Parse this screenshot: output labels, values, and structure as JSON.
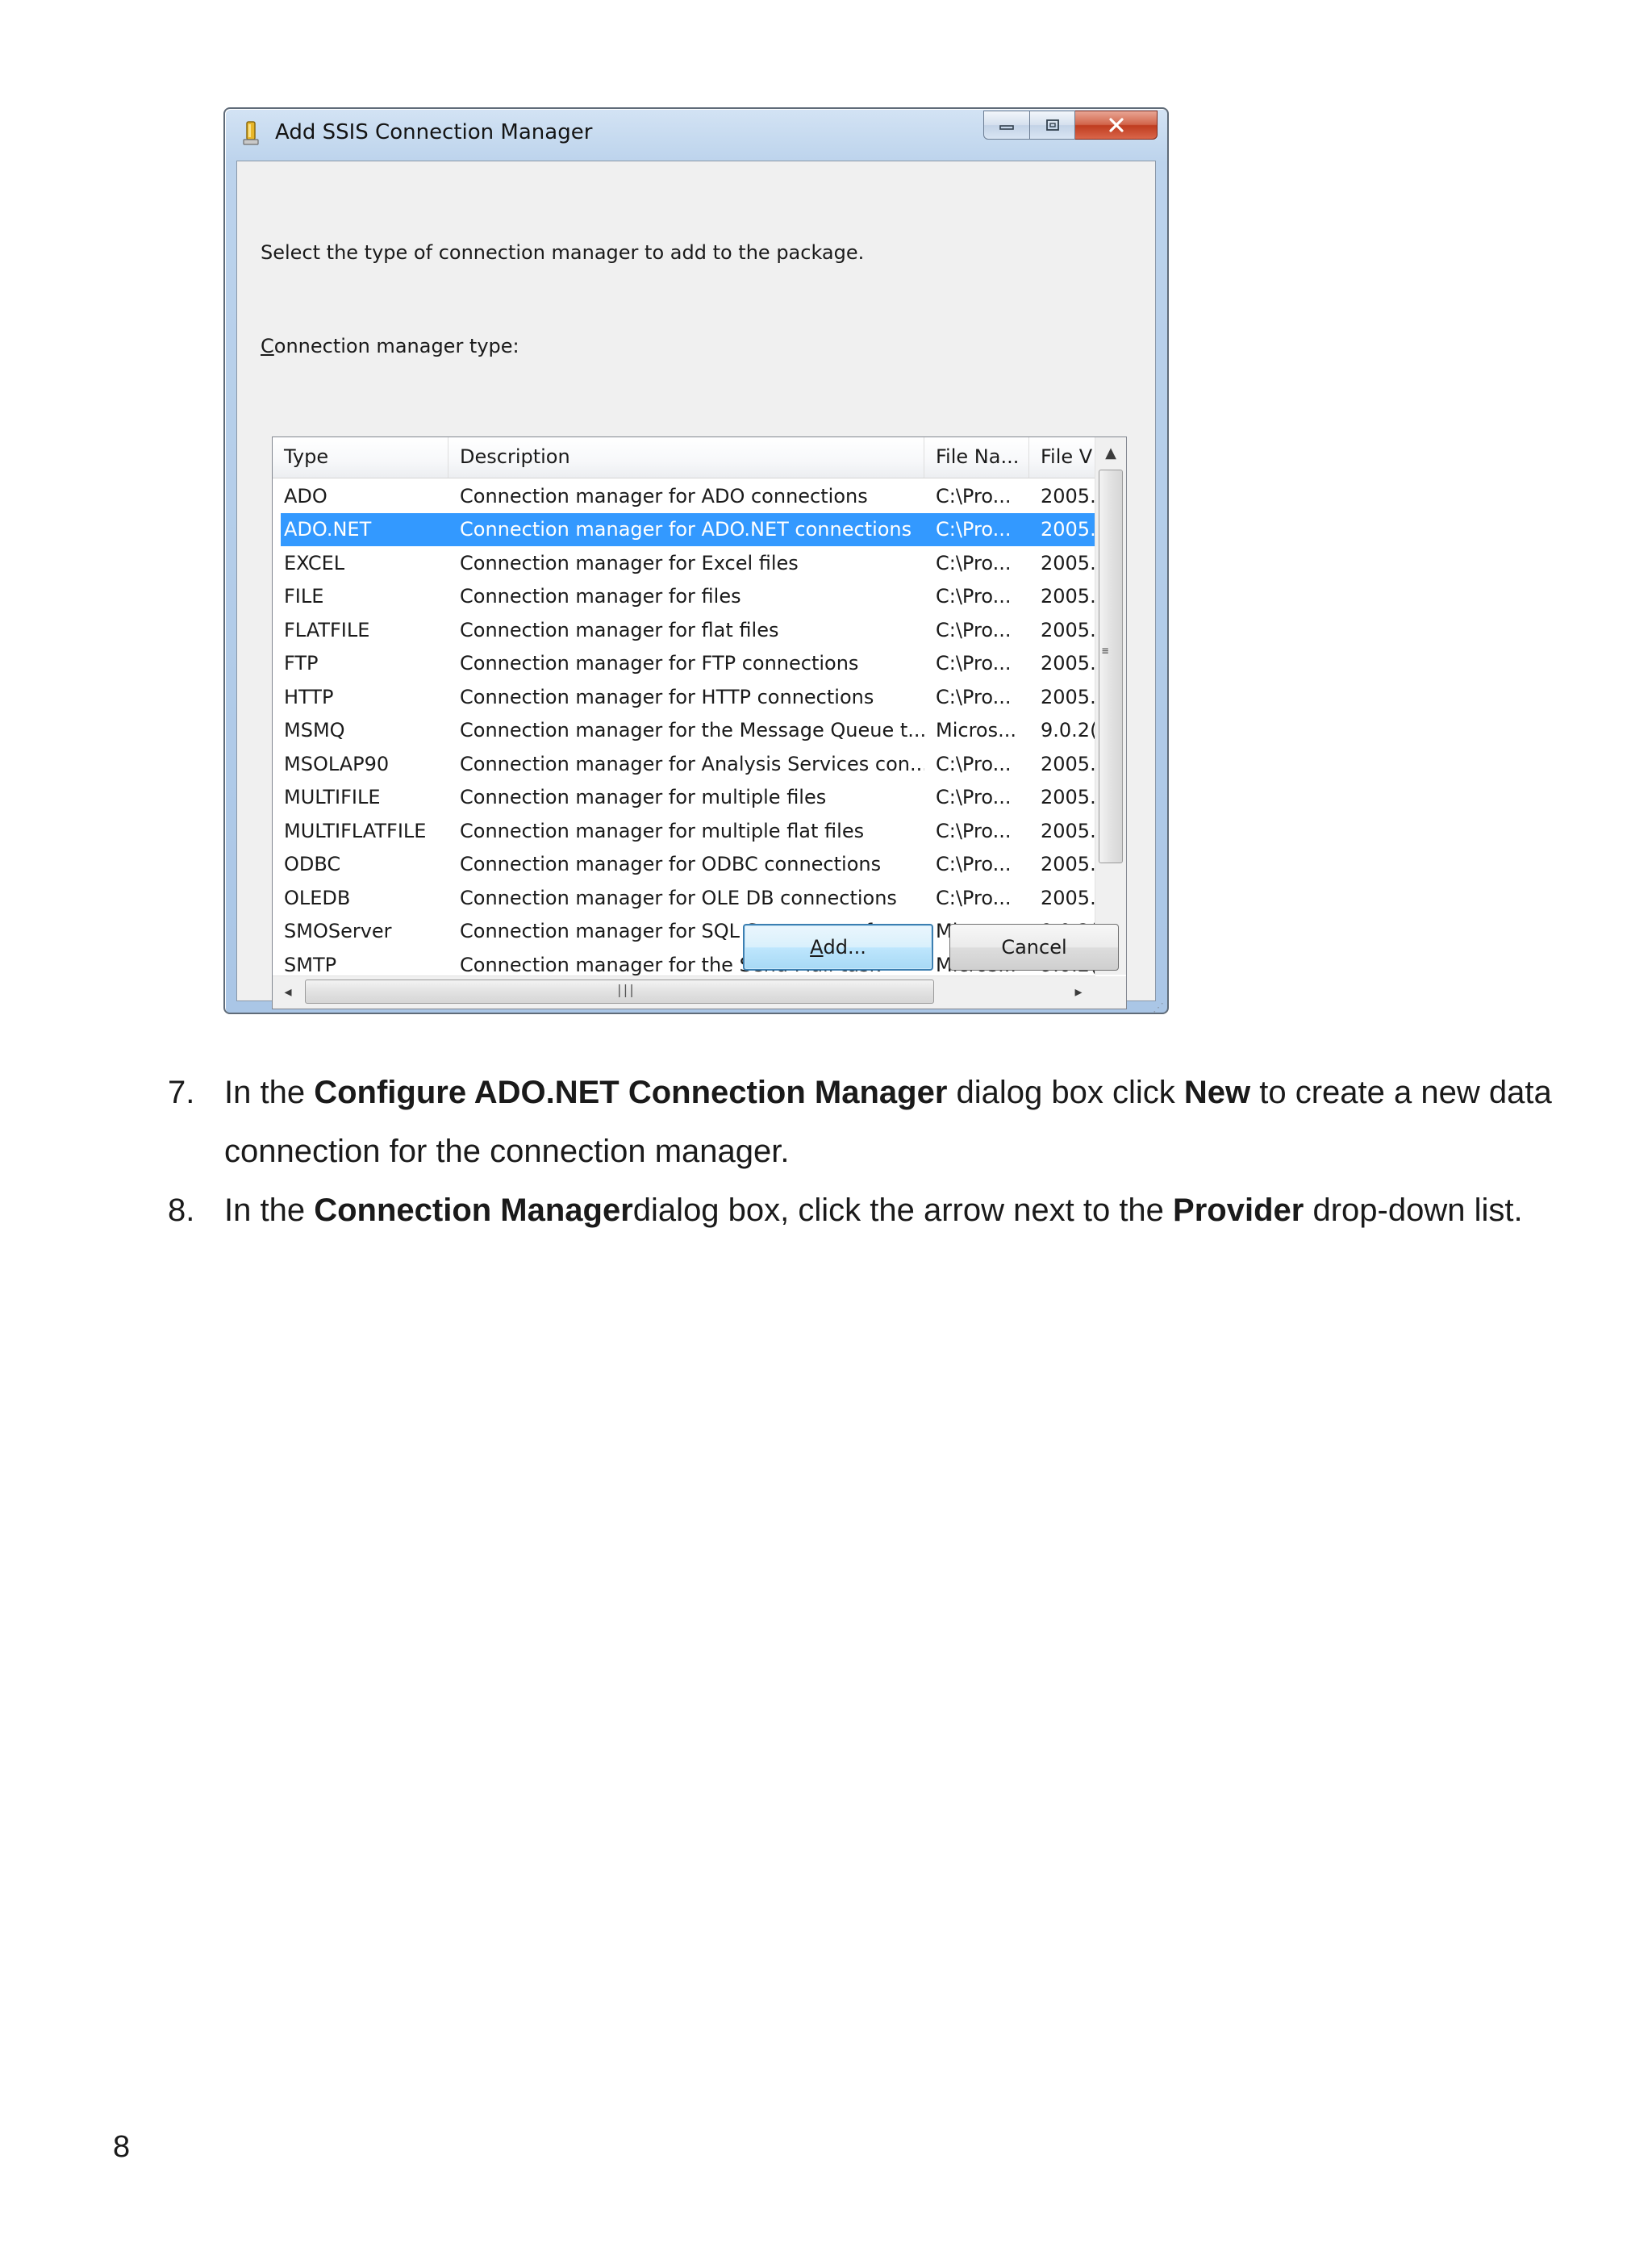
{
  "dialog": {
    "title": "Add SSIS Connection Manager",
    "instruction": "Select the type of connection manager to add to the package.",
    "list_label_accel": "C",
    "list_label_rest": "onnection manager type:",
    "columns": [
      "Type",
      "Description",
      "File Na...",
      "File V"
    ],
    "rows": [
      {
        "type": "ADO",
        "description": "Connection manager for ADO connections",
        "file_name": "C:\\Pro...",
        "file_version": "2005."
      },
      {
        "type": "ADO.NET",
        "description": "Connection manager for ADO.NET connections",
        "file_name": "C:\\Pro...",
        "file_version": "2005."
      },
      {
        "type": "EXCEL",
        "description": "Connection manager for Excel files",
        "file_name": "C:\\Pro...",
        "file_version": "2005."
      },
      {
        "type": "FILE",
        "description": "Connection manager for files",
        "file_name": "C:\\Pro...",
        "file_version": "2005."
      },
      {
        "type": "FLATFILE",
        "description": "Connection manager for flat files",
        "file_name": "C:\\Pro...",
        "file_version": "2005."
      },
      {
        "type": "FTP",
        "description": "Connection manager for FTP connections",
        "file_name": "C:\\Pro...",
        "file_version": "2005."
      },
      {
        "type": "HTTP",
        "description": "Connection manager for HTTP connections",
        "file_name": "C:\\Pro...",
        "file_version": "2005."
      },
      {
        "type": "MSMQ",
        "description": "Connection manager for the Message Queue t...",
        "file_name": "Micros...",
        "file_version": "9.0.2("
      },
      {
        "type": "MSOLAP90",
        "description": "Connection manager for Analysis Services con...",
        "file_name": "C:\\Pro...",
        "file_version": "2005."
      },
      {
        "type": "MULTIFILE",
        "description": "Connection manager for multiple files",
        "file_name": "C:\\Pro...",
        "file_version": "2005."
      },
      {
        "type": "MULTIFLATFILE",
        "description": "Connection manager for multiple flat files",
        "file_name": "C:\\Pro...",
        "file_version": "2005."
      },
      {
        "type": "ODBC",
        "description": "Connection manager for ODBC connections",
        "file_name": "C:\\Pro...",
        "file_version": "2005."
      },
      {
        "type": "OLEDB",
        "description": "Connection manager for OLE DB connections",
        "file_name": "C:\\Pro...",
        "file_version": "2005."
      },
      {
        "type": "SMOServer",
        "description": "Connection manager for SQL Server transfer ta...",
        "file_name": "Micros...",
        "file_version": "9.0.2("
      },
      {
        "type": "SMTP",
        "description": "Connection manager for the Send Mail task",
        "file_name": "Micros...",
        "file_version": "9.0.2("
      }
    ],
    "selected_row": "ADO.NET",
    "add_button_accel": "A",
    "add_button_rest": "dd...",
    "cancel_button": "Cancel",
    "colors": {
      "selection": "#3399ff",
      "close_button": "#c8452a",
      "frame": "#aac6e6"
    }
  },
  "steps": [
    {
      "number": "7.",
      "parts": [
        {
          "text": "In the ",
          "bold": false
        },
        {
          "text": "Configure ADO.NET Connection Manager",
          "bold": true
        },
        {
          "text": " dialog box click ",
          "bold": false
        },
        {
          "text": "New",
          "bold": true
        },
        {
          "text": " to create a new data connection for the connection manager.",
          "bold": false
        }
      ]
    },
    {
      "number": "8.",
      "parts": [
        {
          "text": "In the ",
          "bold": false
        },
        {
          "text": "Connection Manager",
          "bold": true
        },
        {
          "text": "dialog box, click the arrow next to the ",
          "bold": false
        },
        {
          "text": "Provider",
          "bold": true
        },
        {
          "text": " drop-down list.",
          "bold": false
        }
      ]
    }
  ],
  "page_number": "8"
}
